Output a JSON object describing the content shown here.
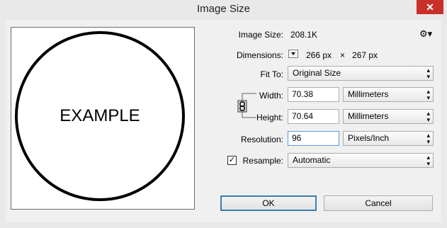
{
  "window": {
    "title": "Image Size",
    "close_glyph": "✕"
  },
  "preview": {
    "text": "EXAMPLE"
  },
  "image_size": {
    "label": "Image Size:",
    "value": "208.1K"
  },
  "dimensions": {
    "label": "Dimensions:",
    "width_px": "266 px",
    "times": "×",
    "height_px": "267 px"
  },
  "fit_to": {
    "label": "Fit To:",
    "value": "Original Size"
  },
  "width": {
    "label": "Width:",
    "value": "70.38",
    "unit": "Millimeters"
  },
  "height": {
    "label": "Height:",
    "value": "70.64",
    "unit": "Millimeters"
  },
  "resolution": {
    "label": "Resolution:",
    "value": "96",
    "unit": "Pixels/Inch"
  },
  "resample": {
    "label": "Resample:",
    "checked": true,
    "check_glyph": "✓",
    "value": "Automatic"
  },
  "buttons": {
    "ok": "OK",
    "cancel": "Cancel"
  },
  "icons": {
    "gear": "⚙▾",
    "link": "chain-link-icon"
  }
}
